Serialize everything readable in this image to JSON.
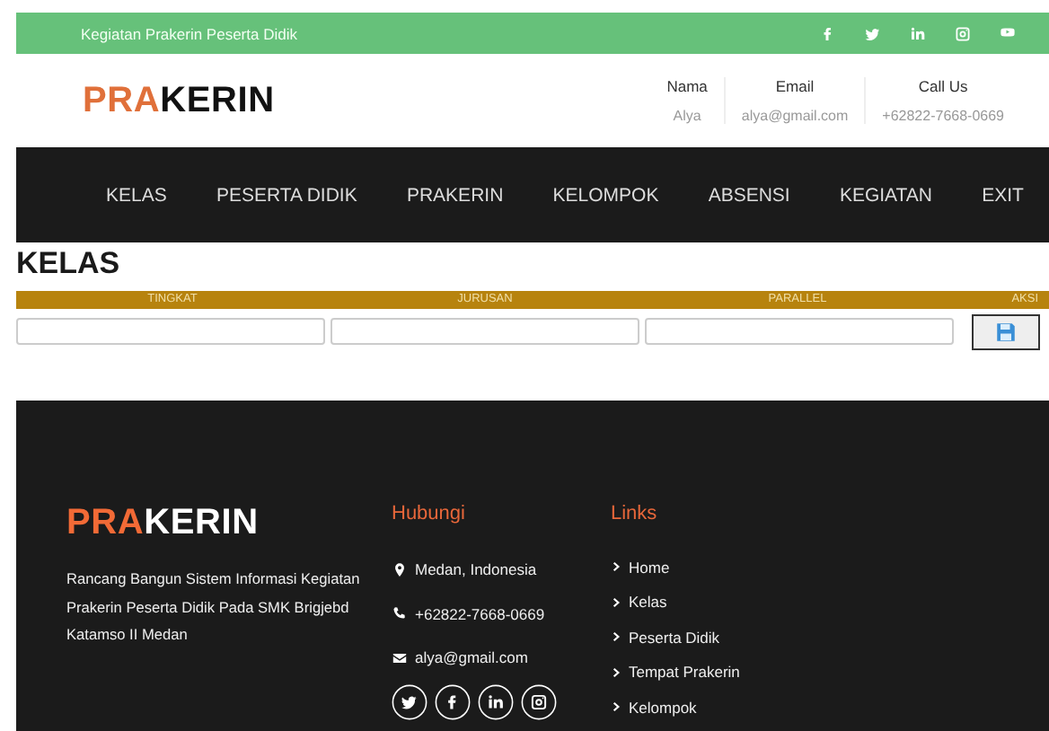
{
  "top_bar": {
    "text": "Kegiatan Prakerin Peserta Didik",
    "social": [
      {
        "kind": "facebook"
      },
      {
        "kind": "twitter"
      },
      {
        "kind": "linkedin"
      },
      {
        "kind": "instagram"
      },
      {
        "kind": "youtube"
      }
    ]
  },
  "header": {
    "logo": {
      "accent": "PRA",
      "rest": "KERIN"
    },
    "info": [
      {
        "label": "Nama",
        "value": "Alya"
      },
      {
        "label": "Email",
        "value": "alya@gmail.com"
      },
      {
        "label": "Call Us",
        "value": "+62822-7668-0669"
      }
    ]
  },
  "nav": [
    "KELAS",
    "PESERTA DIDIK",
    "PRAKERIN",
    "KELOMPOK",
    "ABSENSI",
    "KEGIATAN",
    "EXIT"
  ],
  "page_title": "KELAS",
  "table": {
    "columns": [
      "TINGKAT",
      "JURUSAN",
      "PARALLEL",
      "AKSI"
    ]
  },
  "footer": {
    "logo": {
      "accent": "PRA",
      "rest": "KERIN"
    },
    "description": "Rancang Bangun Sistem Informasi Kegiatan Prakerin Peserta Didik Pada SMK Brigjebd Katamso II Medan",
    "contact": {
      "heading": "Hubungi",
      "items": [
        {
          "kind": "location",
          "text": "Medan, Indonesia"
        },
        {
          "kind": "phone",
          "text": "+62822-7668-0669"
        },
        {
          "kind": "email",
          "text": "alya@gmail.com"
        }
      ],
      "social": [
        {
          "kind": "twitter"
        },
        {
          "kind": "facebook"
        },
        {
          "kind": "linkedin"
        },
        {
          "kind": "instagram"
        }
      ]
    },
    "links": {
      "heading": "Links",
      "items": [
        "Home",
        "Kelas",
        "Peserta Didik",
        "Tempat Prakerin",
        "Kelompok"
      ]
    }
  }
}
